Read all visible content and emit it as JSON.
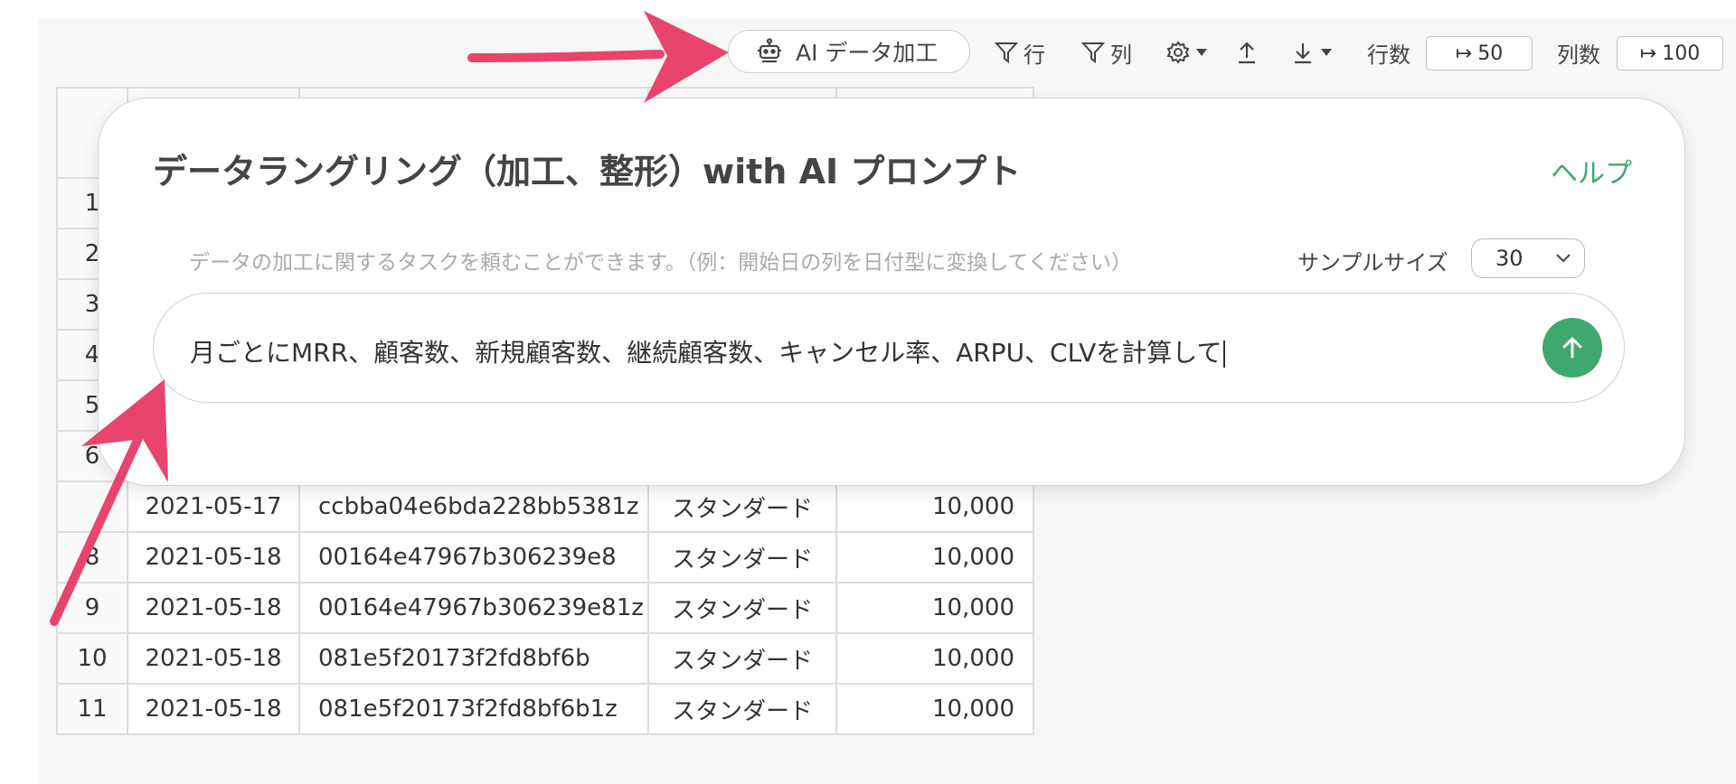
{
  "toolbar": {
    "ai_button_label": "AI データ加工",
    "row_filter_label": "行",
    "col_filter_label": "列",
    "row_count_label": "行数",
    "row_count_value": "50",
    "col_count_label": "列数",
    "col_count_value": "100"
  },
  "table": {
    "rows": [
      {
        "num": "",
        "date": "2021-05-17",
        "id": "ccbba04e6bda228bb5381z",
        "plan": "スタンダード",
        "amount": "10,000"
      },
      {
        "num": "8",
        "date": "2021-05-18",
        "id": "00164e47967b306239e8",
        "plan": "スタンダード",
        "amount": "10,000"
      },
      {
        "num": "9",
        "date": "2021-05-18",
        "id": "00164e47967b306239e81z",
        "plan": "スタンダード",
        "amount": "10,000"
      },
      {
        "num": "10",
        "date": "2021-05-18",
        "id": "081e5f20173f2fd8bf6b",
        "plan": "スタンダード",
        "amount": "10,000"
      },
      {
        "num": "11",
        "date": "2021-05-18",
        "id": "081e5f20173f2fd8bf6b1z",
        "plan": "スタンダード",
        "amount": "10,000"
      }
    ],
    "partial_row_numbers": [
      "1",
      "2",
      "3",
      "4",
      "5",
      "6"
    ]
  },
  "modal": {
    "title": "データラングリング（加工、整形）with AI プロンプト",
    "help_link": "ヘルプ",
    "hint": "データの加工に関するタスクを頼むことができます。（例：開始日の列を日付型に変換してください）",
    "sample_size_label": "サンプルサイズ",
    "sample_size_value": "30",
    "prompt_text": "月ごとにMRR、顧客数、新規顧客数、継続顧客数、キャンセル率、ARPU、CLVを計算して"
  },
  "colors": {
    "accent_green": "#3fa86c",
    "arrow_pink": "#e8446c"
  },
  "icons": [
    "robot-icon",
    "filter-icon",
    "gear-icon",
    "upload-icon",
    "download-icon",
    "arrow-up-icon",
    "chevron-down-icon"
  ]
}
